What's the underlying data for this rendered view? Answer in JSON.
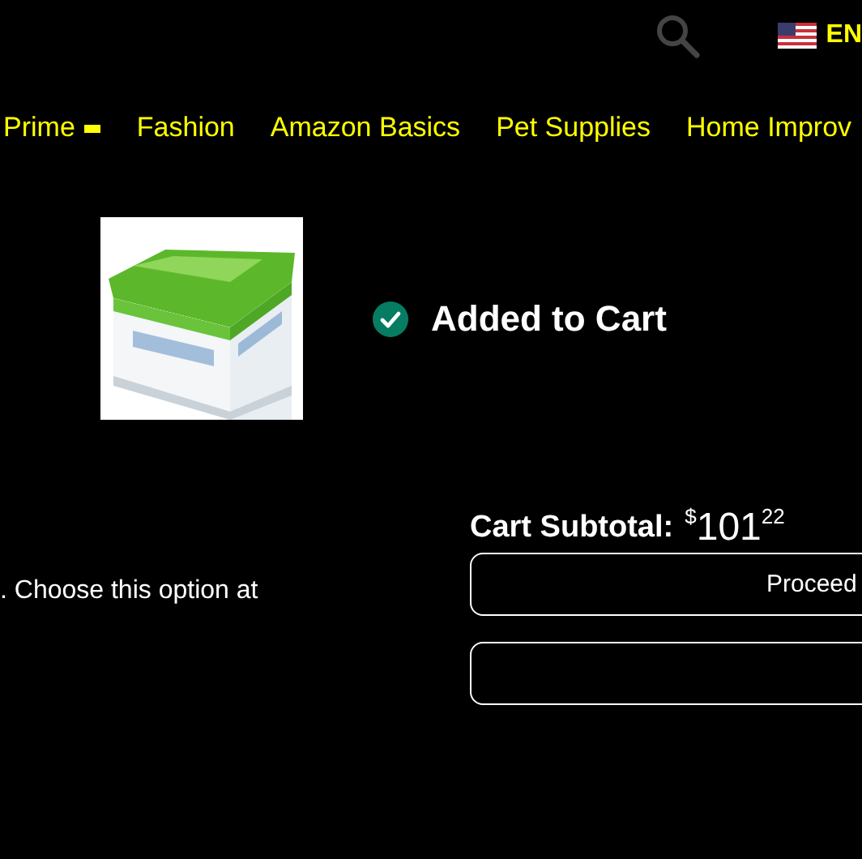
{
  "header": {
    "language": "EN"
  },
  "nav": [
    {
      "label": "Prime",
      "dropdown": true
    },
    {
      "label": "Fashion",
      "dropdown": false
    },
    {
      "label": "Amazon Basics",
      "dropdown": false
    },
    {
      "label": "Pet Supplies",
      "dropdown": false
    },
    {
      "label": "Home Improv",
      "dropdown": false
    }
  ],
  "confirmation": {
    "status": "Added to Cart"
  },
  "note": ". Choose this option at",
  "subtotal": {
    "label": "Cart Subtotal:",
    "currency": "$",
    "whole": "101",
    "fraction": "22"
  },
  "buttons": [
    {
      "kind": "labeled",
      "label": "Proceed"
    },
    {
      "kind": "blank"
    }
  ]
}
